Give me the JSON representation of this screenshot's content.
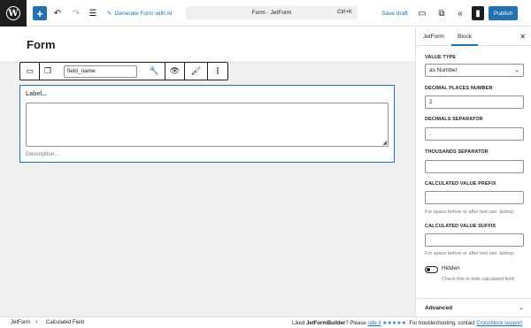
{
  "topbar": {
    "add_icon": "plus-icon",
    "generate_label": "Generate Form with AI",
    "command_title": "Form · JetForm",
    "command_shortcut": "Ctrl+K",
    "save_draft": "Save draft",
    "publish": "Publish",
    "accent_color": "#2271b1"
  },
  "editor": {
    "page_title": "Form",
    "toolbar": {
      "field_name_value": "field_name"
    },
    "field": {
      "label": "Label...",
      "description": "Description..."
    }
  },
  "sidebar": {
    "tabs": [
      {
        "label": "JetForm"
      },
      {
        "label": "Block",
        "active": true
      }
    ],
    "value_type": {
      "label": "VALUE TYPE",
      "value": "as Number"
    },
    "decimal_places": {
      "label": "DECIMAL PLACES NUMBER",
      "value": "2"
    },
    "decimals_separator": {
      "label": "DECIMALS SEPARATOR",
      "value": "."
    },
    "thousands_separator": {
      "label": "THOUSANDS SEPARATOR",
      "value": ""
    },
    "prefix": {
      "label": "CALCULATED VALUE PREFIX",
      "value": "",
      "help": "For space before or after text use: &nbsp;"
    },
    "suffix": {
      "label": "CALCULATED VALUE SUFFIX",
      "value": "",
      "help": "For space before or after text use: &nbsp;"
    },
    "hidden": {
      "label": "Hidden",
      "help": "Check this to hide calculated field",
      "checked": false
    },
    "advanced": "Advanced"
  },
  "footer": {
    "breadcrumb": [
      "JetForm",
      "Calculated Field"
    ],
    "msg_prefix": "Liked ",
    "msg_brand": "JetFormBuilder",
    "msg_mid": "? Please ",
    "msg_rate": "rate it",
    "msg_stars": "★★★★★",
    "msg_after": ". For troubleshooting, contact ",
    "msg_link": "Crocoblock support"
  }
}
